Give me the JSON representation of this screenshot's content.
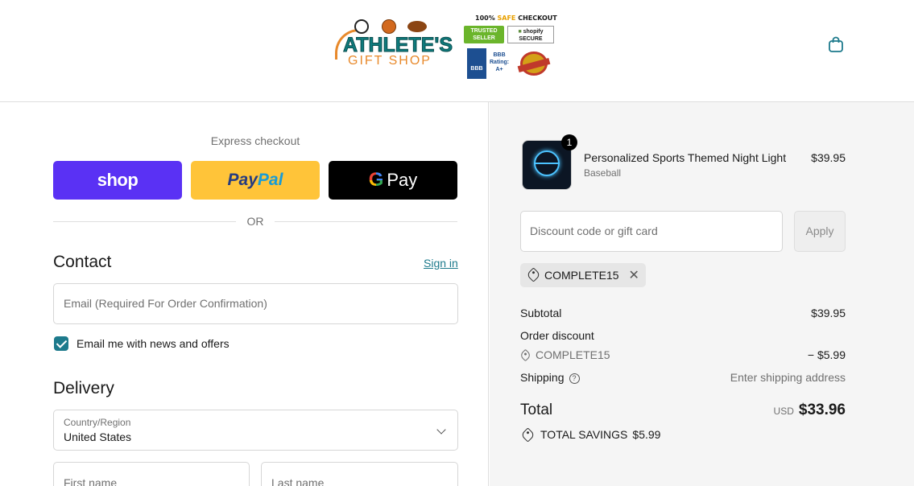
{
  "header": {
    "logo_line1": "ATHLETE'S",
    "logo_line2": "GIFT SHOP",
    "badges": {
      "safe_a": "100%",
      "safe_b": "SAFE",
      "safe_c": "CHECKOUT",
      "trusted": "TRUSTED SELLER",
      "shopify": "shopify",
      "shopify_sub": "SECURE",
      "bbb": "BBB",
      "bbb_rating_1": "BBB",
      "bbb_rating_2": "Rating:",
      "bbb_rating_3": "A+"
    },
    "cart_icon": "shopping-bag-icon"
  },
  "checkout": {
    "express_title": "Express checkout",
    "shop_label": "shop",
    "paypal_label_1": "Pay",
    "paypal_label_2": "Pal",
    "gpay_g": "G",
    "gpay_label": "Pay",
    "or_label": "OR",
    "contact": {
      "title": "Contact",
      "signin": "Sign in",
      "email_placeholder": "Email (Required For Order Confirmation)",
      "newsletter_label": "Email me with news and offers",
      "newsletter_checked": true
    },
    "delivery": {
      "title": "Delivery",
      "country_caption": "Country/Region",
      "country_value": "United States",
      "first_name_placeholder": "First name",
      "last_name_placeholder": "Last name"
    }
  },
  "summary": {
    "item": {
      "name": "Personalized Sports Themed Night Light",
      "variant": "Baseball",
      "price": "$39.95",
      "quantity": "1"
    },
    "discount_placeholder": "Discount code or gift card",
    "apply_label": "Apply",
    "applied_code": "COMPLETE15",
    "remove_icon": "close-icon",
    "subtotal_label": "Subtotal",
    "subtotal_value": "$39.95",
    "order_discount_label": "Order discount",
    "discount_code": "COMPLETE15",
    "discount_value": "− $5.99",
    "shipping_label": "Shipping",
    "shipping_value": "Enter shipping address",
    "total_label": "Total",
    "currency": "USD",
    "total_value": "$33.96",
    "savings_label": "TOTAL SAVINGS",
    "savings_value": "$5.99"
  },
  "colors": {
    "accent": "#1d7a8c",
    "shop_pay": "#5a31f4",
    "paypal": "#ffc439",
    "gpay": "#000000",
    "summary_bg": "#f5f5f5"
  }
}
